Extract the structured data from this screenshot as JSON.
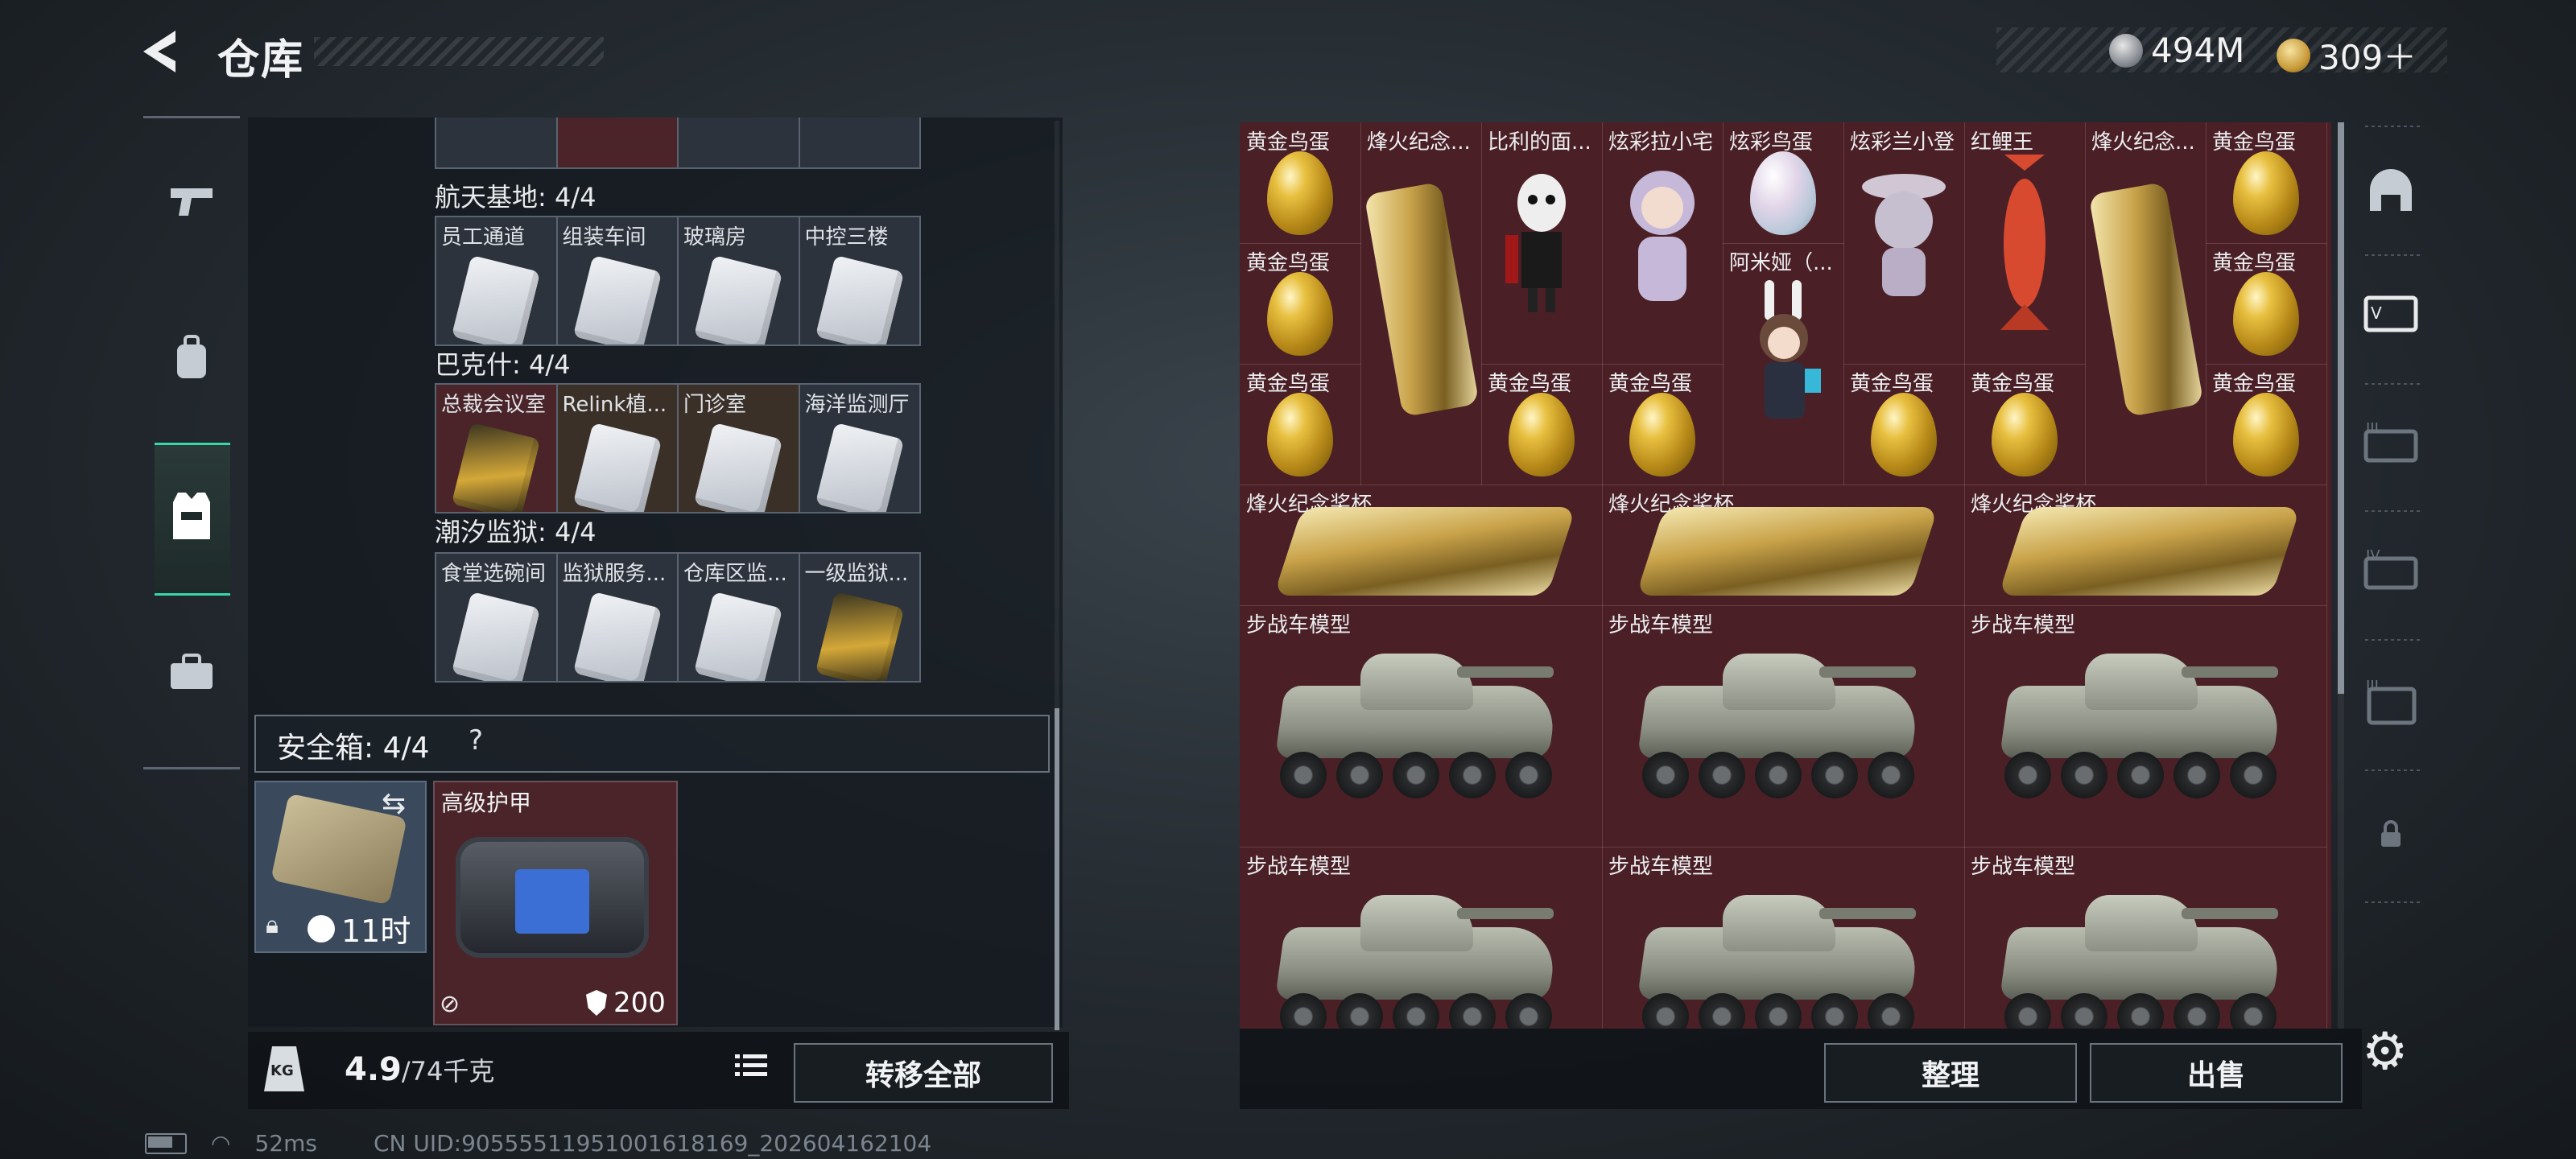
{
  "header": {
    "title": "仓库",
    "back_icon": "back-arrow-icon"
  },
  "currency": [
    {
      "icon": "silver-coin-icon",
      "value": "494M"
    },
    {
      "icon": "gold-coin-icon",
      "value": "309＋"
    }
  ],
  "left_rail": {
    "items": [
      "pistol-icon",
      "backpack-icon",
      "vest-icon",
      "toolbox-icon"
    ],
    "active": "vest-icon"
  },
  "storage": {
    "sections": [
      {
        "title": "航天基地: 4/4",
        "cells": [
          {
            "label": "员工通道"
          },
          {
            "label": "组装车间"
          },
          {
            "label": "玻璃房"
          },
          {
            "label": "中控三楼"
          }
        ]
      },
      {
        "title": "巴克什: 4/4",
        "cells": [
          {
            "label": "总裁会议室",
            "style": "gold"
          },
          {
            "label": "Relink植..."
          },
          {
            "label": "门诊室"
          },
          {
            "label": "海洋监测厅"
          }
        ]
      },
      {
        "title": "潮汐监狱: 4/4",
        "cells": [
          {
            "label": "食堂选碗间"
          },
          {
            "label": "监狱服务..."
          },
          {
            "label": "仓库区监..."
          },
          {
            "label": "一级监狱..."
          }
        ]
      }
    ]
  },
  "safe_box": {
    "label": "安全箱: 4/4",
    "help": "?",
    "timer": "11时",
    "armor_label": "高级护甲",
    "durability": "200"
  },
  "footer_left": {
    "weight_value": "4.9",
    "weight_max": "/74千克",
    "kg_icon_text": "KG",
    "transfer_label": "转移全部"
  },
  "status_bar": {
    "ping": "52ms",
    "uid": "CN UID:9055551195100161816​9_202604162104"
  },
  "right_grid": {
    "small_items": [
      {
        "label": "黄金鸟蛋"
      },
      {
        "label": "烽火纪念..."
      },
      {
        "label": "比利的面..."
      },
      {
        "label": "炫彩拉小宅"
      },
      {
        "label": "炫彩鸟蛋"
      },
      {
        "label": "炫彩兰小登"
      },
      {
        "label": "红鲤王"
      },
      {
        "label": "烽火纪念..."
      },
      {
        "label": "黄金鸟蛋"
      },
      {
        "label": "黄金鸟蛋"
      },
      {
        "label": "阿米娅（..."
      },
      {
        "label": "黄金鸟蛋"
      },
      {
        "label": "黄金鸟蛋"
      },
      {
        "label": "黄金鸟蛋"
      },
      {
        "label": "黄金鸟蛋"
      },
      {
        "label": "黄金鸟蛋"
      },
      {
        "label": "黄金鸟蛋"
      },
      {
        "label": "黄金鸟蛋"
      }
    ],
    "trophies": [
      {
        "label": "烽火纪念奖杯"
      },
      {
        "label": "烽火纪念奖杯"
      },
      {
        "label": "烽火纪念奖杯"
      }
    ],
    "tanks": [
      {
        "label": "步战车模型"
      },
      {
        "label": "步战车模型"
      },
      {
        "label": "步战车模型"
      },
      {
        "label": "步战车模型"
      },
      {
        "label": "步战车模型"
      },
      {
        "label": "步战车模型"
      }
    ]
  },
  "footer_right": {
    "sort_label": "整理",
    "sell_label": "出售"
  },
  "right_rail": {
    "items": [
      "helmet-icon",
      "armor-ticket-icon",
      "level3-ticket-icon",
      "level4-ticket-icon",
      "level3-map-icon",
      "lock-icon"
    ]
  },
  "colors": {
    "accent": "#38d6a8",
    "grid_bg": "#4a2026",
    "panel_bg": "#12171d"
  }
}
